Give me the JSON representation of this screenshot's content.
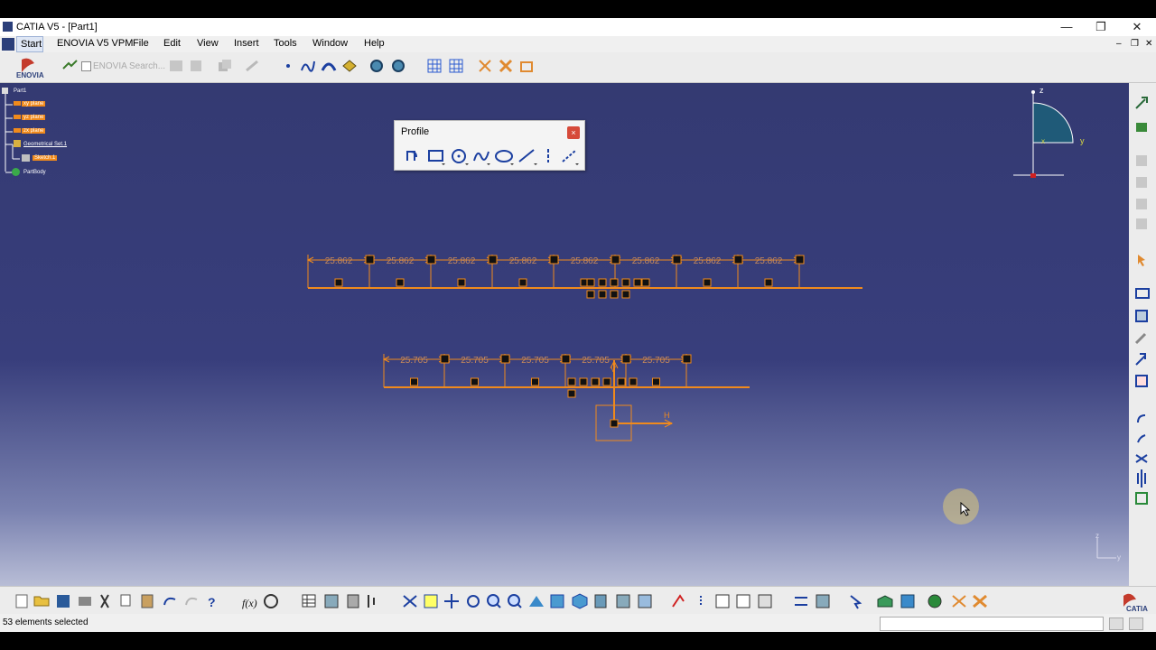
{
  "window": {
    "title": "CATIA V5 - [Part1]",
    "minimize": "—",
    "restore": "❐",
    "close": "✕"
  },
  "menu": [
    "Start",
    "ENOVIA V5 VPM",
    "File",
    "Edit",
    "View",
    "Insert",
    "Tools",
    "Window",
    "Help"
  ],
  "toolbar": {
    "enovia_search_placeholder": "ENOVIA Search..."
  },
  "tree": {
    "root": "Part1",
    "items": [
      {
        "label": "xy plane",
        "highlight": true
      },
      {
        "label": "yz plane",
        "highlight": true
      },
      {
        "label": "zx plane",
        "highlight": true
      },
      {
        "label": "Geometrical Set.1",
        "highlight": false
      },
      {
        "label": "Sketch.1",
        "highlight": true
      },
      {
        "label": "PartBody",
        "highlight": false
      }
    ]
  },
  "profile_toolbar": {
    "title": "Profile",
    "close": "×"
  },
  "sketch": {
    "row1_dimensions": [
      "25.862",
      "25.862",
      "25.862",
      "25.862",
      "25.862",
      "25.862",
      "25.862",
      "25.862"
    ],
    "row2_dimensions": [
      "25.705",
      "25.705",
      "25.705",
      "25.705",
      "25.705"
    ],
    "axis_h": "H",
    "axis_v": "V",
    "accent_color": "#f08a1c"
  },
  "compass": {
    "z": "z",
    "y": "y",
    "x": "x"
  },
  "status": {
    "text": "53 elements selected"
  },
  "logos": {
    "top": "ENOVIA",
    "bottom": "CATIA"
  }
}
